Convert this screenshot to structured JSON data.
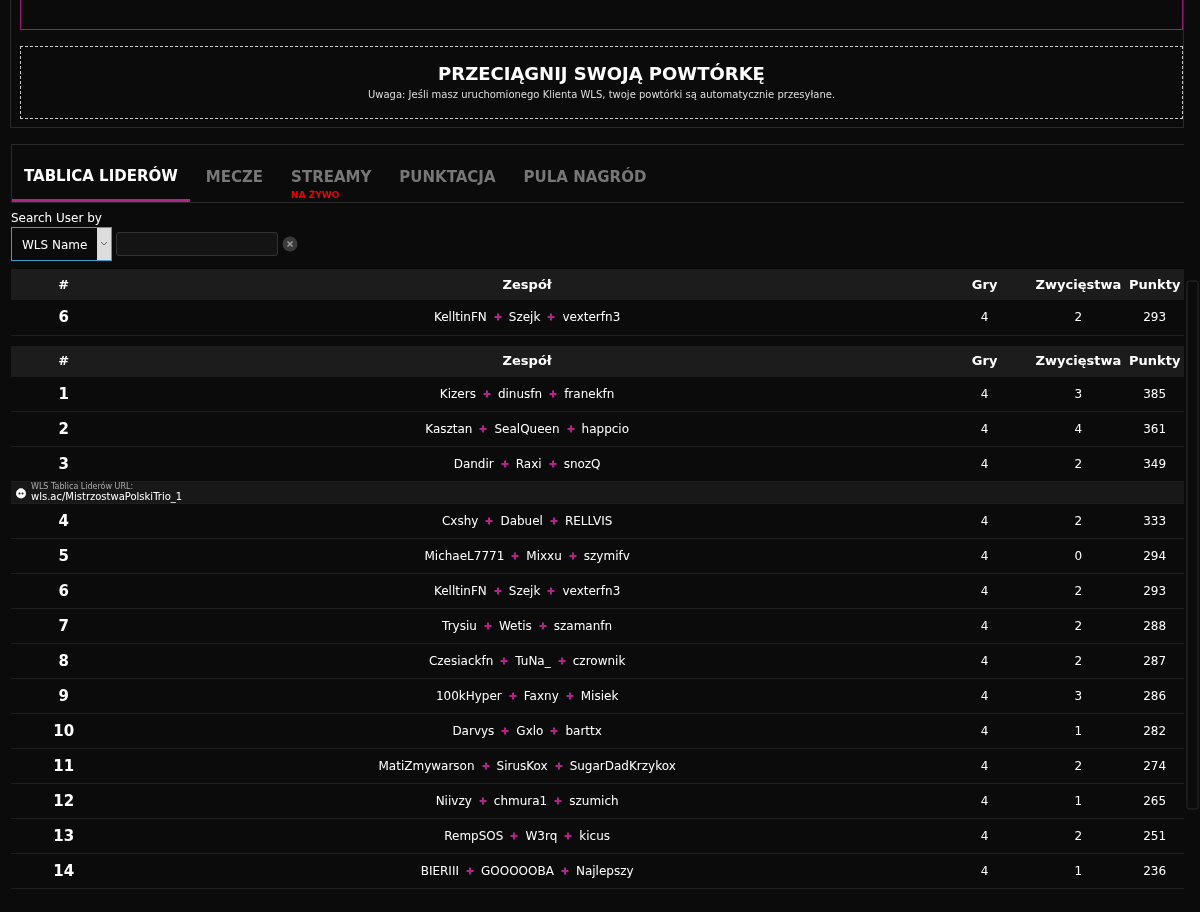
{
  "drop_zone": {
    "title": "PRZECIĄGNIJ SWOJĄ POWTÓRKĘ",
    "note": "Uwaga: Jeśli masz uruchomionego Klienta WLS, twoje powtórki są automatycznie przesyłane."
  },
  "tabs": [
    {
      "label": "TABLICA LIDERÓW",
      "selected": true
    },
    {
      "label": "MECZE",
      "selected": false
    },
    {
      "label": "STREAMY",
      "selected": false,
      "badge": "NA ŻYWO"
    },
    {
      "label": "PUNKTACJA",
      "selected": false
    },
    {
      "label": "PULA NAGRÓD",
      "selected": false
    }
  ],
  "search": {
    "label": "Search User by",
    "select_value": "WLS Name"
  },
  "my_team": {
    "columns": [
      "#",
      "Zespół",
      "Gry",
      "Zwycięstwa",
      "Punkty"
    ],
    "rows": [
      {
        "kind": "team",
        "rank": "6",
        "players": [
          "KelltinFN",
          "Szejk",
          "vexterfn3"
        ],
        "games": "4",
        "wins": "2",
        "points": "293"
      }
    ]
  },
  "leaderboard": {
    "columns": [
      "#",
      "Zespół",
      "Gry",
      "Zwycięstwa",
      "Punkty"
    ],
    "rows": [
      {
        "kind": "team",
        "rank": "1",
        "players": [
          "Kizers",
          "dinusfn",
          "franekfn"
        ],
        "games": "4",
        "wins": "3",
        "points": "385"
      },
      {
        "kind": "team",
        "rank": "2",
        "players": [
          "Kasztan",
          "SealQueen",
          "happcio"
        ],
        "games": "4",
        "wins": "4",
        "points": "361"
      },
      {
        "kind": "team",
        "rank": "3",
        "players": [
          "Dandir",
          "Raxi",
          "snozQ"
        ],
        "games": "4",
        "wins": "2",
        "points": "349"
      },
      {
        "kind": "banner",
        "label": "WLS Tablica Liderów URL:",
        "url": "wls.ac/MistrzostwaPolskiTrio_1"
      },
      {
        "kind": "team",
        "rank": "4",
        "players": [
          "Cxshy",
          "Dabuel",
          "RELLVIS"
        ],
        "games": "4",
        "wins": "2",
        "points": "333"
      },
      {
        "kind": "team",
        "rank": "5",
        "players": [
          "MichaeL7771",
          "Mixxu",
          "szymifv"
        ],
        "games": "4",
        "wins": "0",
        "points": "294"
      },
      {
        "kind": "team",
        "rank": "6",
        "players": [
          "KelltinFN",
          "Szejk",
          "vexterfn3"
        ],
        "games": "4",
        "wins": "2",
        "points": "293"
      },
      {
        "kind": "team",
        "rank": "7",
        "players": [
          "Trysiu",
          "Wetis",
          "szamanfn"
        ],
        "games": "4",
        "wins": "2",
        "points": "288"
      },
      {
        "kind": "team",
        "rank": "8",
        "players": [
          "Czesiackfn",
          "TuNa_",
          "czrownik"
        ],
        "games": "4",
        "wins": "2",
        "points": "287"
      },
      {
        "kind": "team",
        "rank": "9",
        "players": [
          "100kHyper",
          "Faxny",
          "Misiek"
        ],
        "games": "4",
        "wins": "3",
        "points": "286"
      },
      {
        "kind": "team",
        "rank": "10",
        "players": [
          "Darvys",
          "Gxlo",
          "barttx"
        ],
        "games": "4",
        "wins": "1",
        "points": "282"
      },
      {
        "kind": "team",
        "rank": "11",
        "players": [
          "MatiZmywarson",
          "SirusKox",
          "SugarDadKrzykox"
        ],
        "games": "4",
        "wins": "2",
        "points": "274"
      },
      {
        "kind": "team",
        "rank": "12",
        "players": [
          "Niivzy",
          "chmura1",
          "szumich"
        ],
        "games": "4",
        "wins": "1",
        "points": "265"
      },
      {
        "kind": "team",
        "rank": "13",
        "players": [
          "RempSOS",
          "W3rq",
          "kicus"
        ],
        "games": "4",
        "wins": "2",
        "points": "251"
      },
      {
        "kind": "team",
        "rank": "14",
        "players": [
          "BIERIII",
          "GOOOOOBA",
          "Najlepszy"
        ],
        "games": "4",
        "wins": "1",
        "points": "236"
      }
    ]
  }
}
